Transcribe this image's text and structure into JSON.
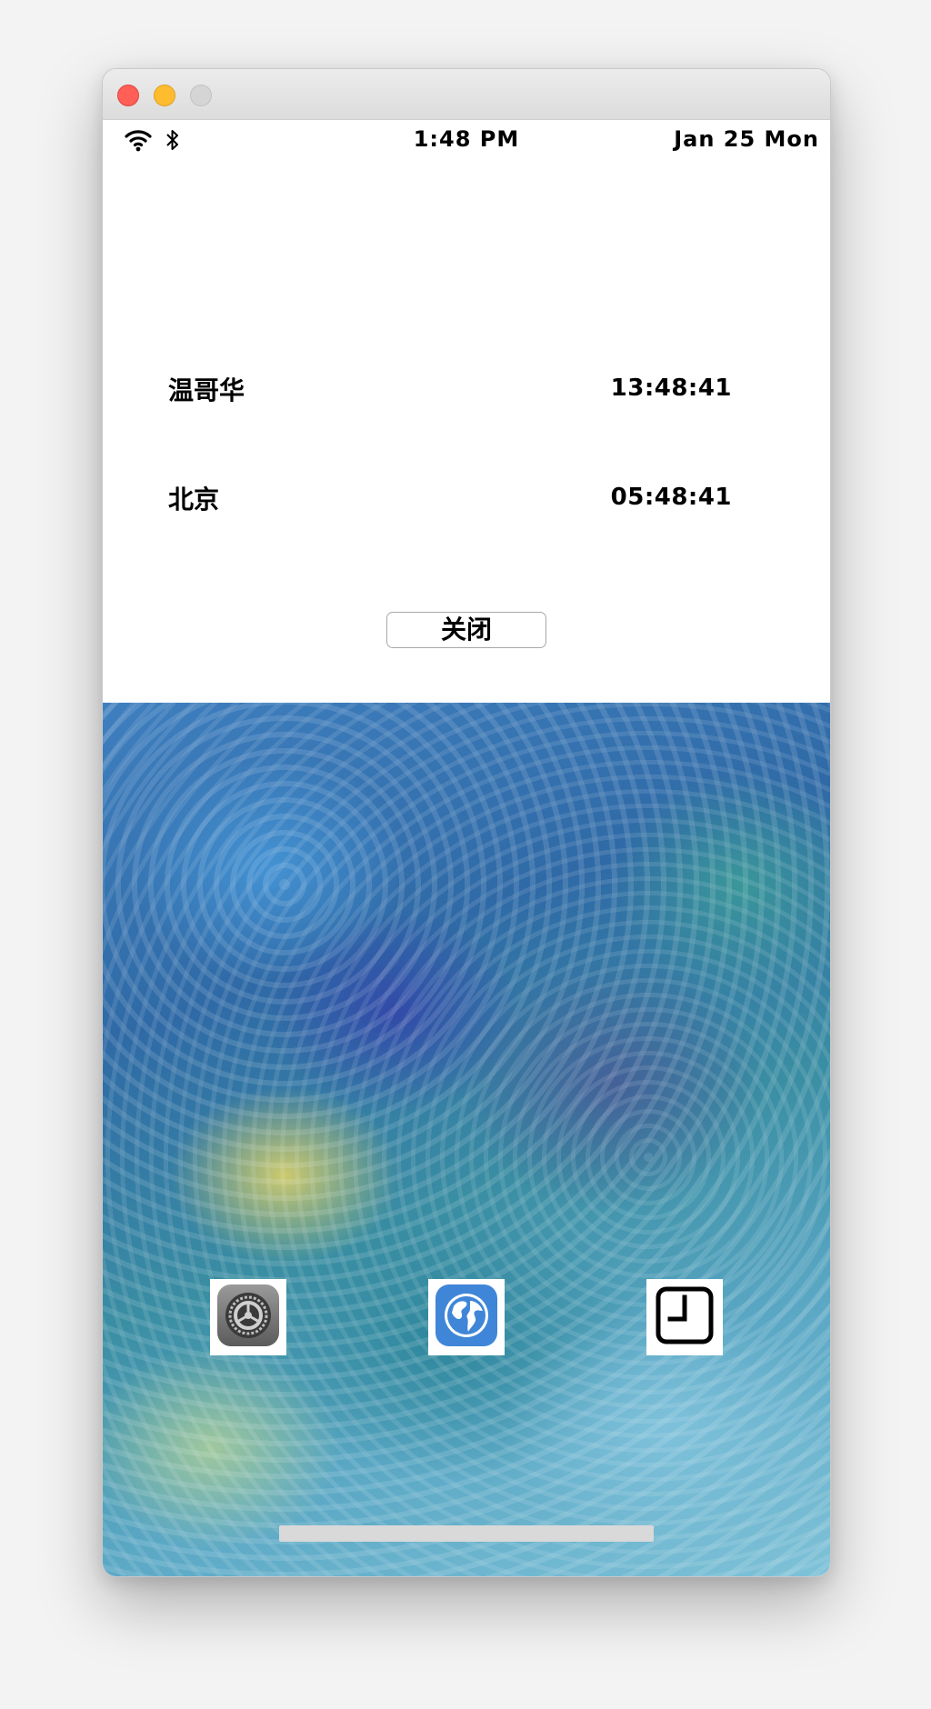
{
  "statusbar": {
    "time": "1:48 PM",
    "date": "Jan 25 Mon",
    "wifi_icon": "wifi-icon",
    "bluetooth_icon": "bluetooth-icon"
  },
  "clock_list": [
    {
      "city": "温哥华",
      "time": "13:48:41"
    },
    {
      "city": "北京",
      "time": "05:48:41"
    }
  ],
  "close_button": {
    "label": "关闭"
  },
  "dock": [
    {
      "name": "settings",
      "icon": "settings-icon"
    },
    {
      "name": "browser",
      "icon": "globe-icon"
    },
    {
      "name": "clock",
      "icon": "clock-icon"
    }
  ]
}
